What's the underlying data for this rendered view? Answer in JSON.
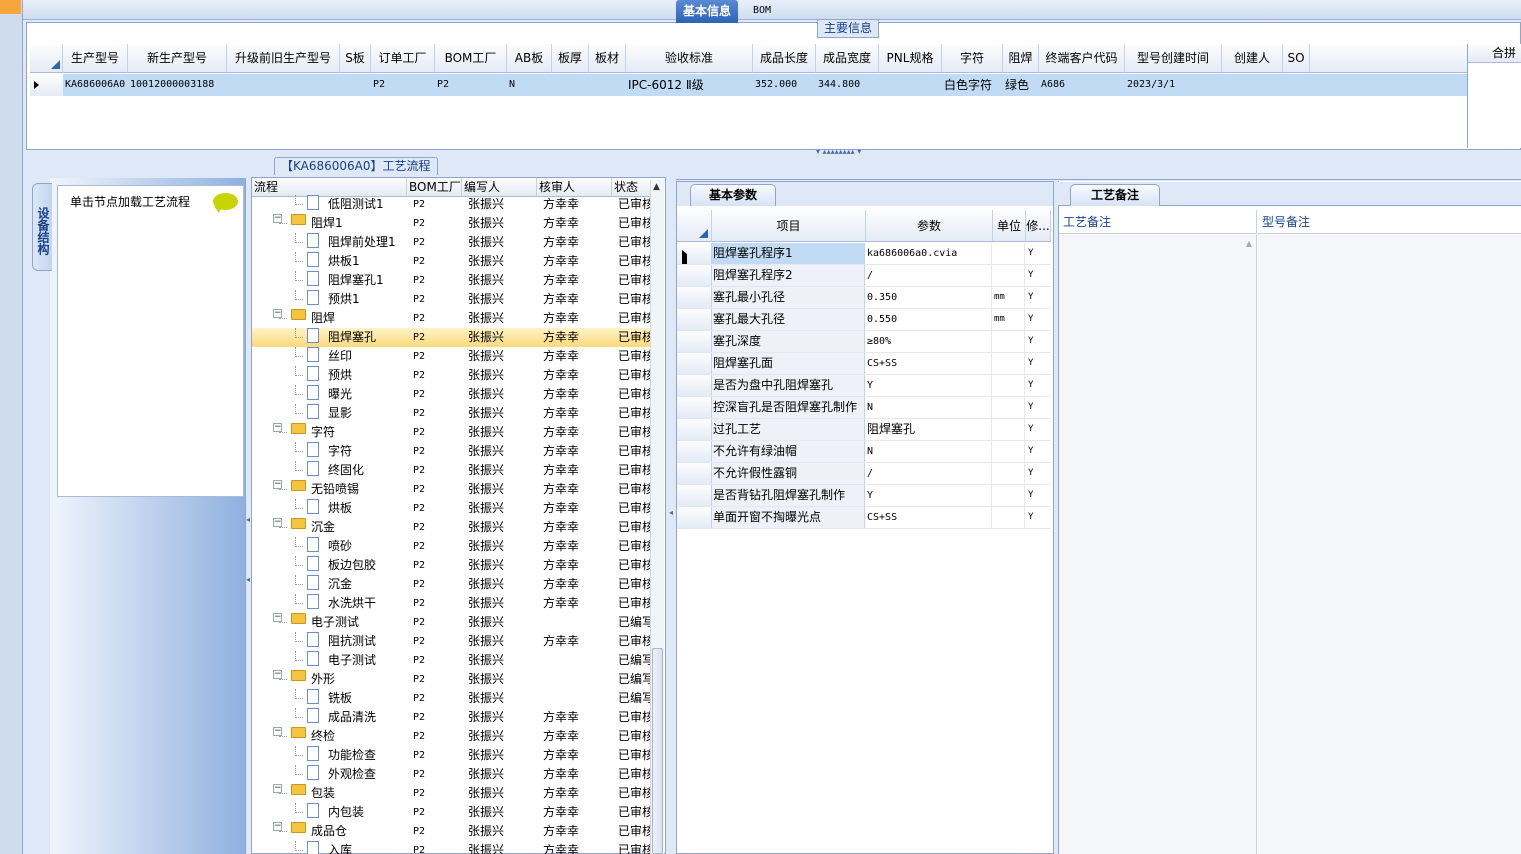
{
  "colors": {
    "accent": "#15428b",
    "selected_row": "#c2dbf5",
    "tree_selected": "#f9d97a",
    "folder": "#f5c443"
  },
  "main_info": {
    "title": "主要信息",
    "columns": [
      "生产型号",
      "新生产型号",
      "升级前旧生产型号",
      "S板",
      "订单工厂",
      "BOM工厂",
      "AB板",
      "板厚",
      "板材",
      "验收标准",
      "成品长度",
      "成品宽度",
      "PNL规格",
      "字符",
      "阻焊",
      "终端客户代码",
      "型号创建时间",
      "创建人",
      "SO"
    ],
    "row": [
      "KA686006A0",
      "10012000003188",
      "",
      "",
      "P2",
      "P2",
      "N",
      "",
      "",
      "IPC-6012 Ⅱ级",
      "352.000",
      "344.800",
      "",
      "白色字符",
      "绿色",
      "A686",
      "2023/3/1",
      "",
      ""
    ],
    "merge_label": "合拼"
  },
  "left_panel": {
    "vertical_tab": "设备结构",
    "hint": "单击节点加载工艺流程"
  },
  "process_tree": {
    "title": "【KA686006A0】工艺流程",
    "columns": [
      "流程",
      "BOM工厂",
      "编写人",
      "核审人",
      "状态"
    ],
    "rows": [
      {
        "name": "低阻测试1",
        "level": 2,
        "factory": "P2",
        "author": "张振兴",
        "reviewer": "方幸幸",
        "status": "已审核"
      },
      {
        "name": "阻焊1",
        "level": 1,
        "factory": "P2",
        "author": "张振兴",
        "reviewer": "方幸幸",
        "status": "已审核"
      },
      {
        "name": "阻焊前处理1",
        "level": 2,
        "factory": "P2",
        "author": "张振兴",
        "reviewer": "方幸幸",
        "status": "已审核"
      },
      {
        "name": "烘板1",
        "level": 2,
        "factory": "P2",
        "author": "张振兴",
        "reviewer": "方幸幸",
        "status": "已审核"
      },
      {
        "name": "阻焊塞孔1",
        "level": 2,
        "factory": "P2",
        "author": "张振兴",
        "reviewer": "方幸幸",
        "status": "已审核"
      },
      {
        "name": "预烘1",
        "level": 2,
        "factory": "P2",
        "author": "张振兴",
        "reviewer": "方幸幸",
        "status": "已审核"
      },
      {
        "name": "阻焊",
        "level": 1,
        "factory": "P2",
        "author": "张振兴",
        "reviewer": "方幸幸",
        "status": "已审核"
      },
      {
        "name": "阻焊塞孔",
        "level": 2,
        "factory": "P2",
        "author": "张振兴",
        "reviewer": "方幸幸",
        "status": "已审核",
        "selected": true
      },
      {
        "name": "丝印",
        "level": 2,
        "factory": "P2",
        "author": "张振兴",
        "reviewer": "方幸幸",
        "status": "已审核"
      },
      {
        "name": "预烘",
        "level": 2,
        "factory": "P2",
        "author": "张振兴",
        "reviewer": "方幸幸",
        "status": "已审核"
      },
      {
        "name": "曝光",
        "level": 2,
        "factory": "P2",
        "author": "张振兴",
        "reviewer": "方幸幸",
        "status": "已审核"
      },
      {
        "name": "显影",
        "level": 2,
        "factory": "P2",
        "author": "张振兴",
        "reviewer": "方幸幸",
        "status": "已审核"
      },
      {
        "name": "字符",
        "level": 1,
        "factory": "P2",
        "author": "张振兴",
        "reviewer": "方幸幸",
        "status": "已审核"
      },
      {
        "name": "字符",
        "level": 2,
        "factory": "P2",
        "author": "张振兴",
        "reviewer": "方幸幸",
        "status": "已审核"
      },
      {
        "name": "终固化",
        "level": 2,
        "factory": "P2",
        "author": "张振兴",
        "reviewer": "方幸幸",
        "status": "已审核"
      },
      {
        "name": "无铅喷锡",
        "level": 1,
        "factory": "P2",
        "author": "张振兴",
        "reviewer": "方幸幸",
        "status": "已审核"
      },
      {
        "name": "烘板",
        "level": 2,
        "factory": "P2",
        "author": "张振兴",
        "reviewer": "方幸幸",
        "status": "已审核"
      },
      {
        "name": "沉金",
        "level": 1,
        "factory": "P2",
        "author": "张振兴",
        "reviewer": "方幸幸",
        "status": "已审核"
      },
      {
        "name": "喷砂",
        "level": 2,
        "factory": "P2",
        "author": "张振兴",
        "reviewer": "方幸幸",
        "status": "已审核"
      },
      {
        "name": "板边包胶",
        "level": 2,
        "factory": "P2",
        "author": "张振兴",
        "reviewer": "方幸幸",
        "status": "已审核"
      },
      {
        "name": "沉金",
        "level": 2,
        "factory": "P2",
        "author": "张振兴",
        "reviewer": "方幸幸",
        "status": "已审核"
      },
      {
        "name": "水洗烘干",
        "level": 2,
        "factory": "P2",
        "author": "张振兴",
        "reviewer": "方幸幸",
        "status": "已审核"
      },
      {
        "name": "电子测试",
        "level": 1,
        "factory": "P2",
        "author": "张振兴",
        "reviewer": "",
        "status": "已编写"
      },
      {
        "name": "阻抗测试",
        "level": 2,
        "factory": "P2",
        "author": "张振兴",
        "reviewer": "方幸幸",
        "status": "已审核"
      },
      {
        "name": "电子测试",
        "level": 2,
        "factory": "P2",
        "author": "张振兴",
        "reviewer": "",
        "status": "已编写"
      },
      {
        "name": "外形",
        "level": 1,
        "factory": "P2",
        "author": "张振兴",
        "reviewer": "",
        "status": "已编写"
      },
      {
        "name": "铣板",
        "level": 2,
        "factory": "P2",
        "author": "张振兴",
        "reviewer": "",
        "status": "已编写"
      },
      {
        "name": "成品清洗",
        "level": 2,
        "factory": "P2",
        "author": "张振兴",
        "reviewer": "方幸幸",
        "status": "已审核"
      },
      {
        "name": "终检",
        "level": 1,
        "factory": "P2",
        "author": "张振兴",
        "reviewer": "方幸幸",
        "status": "已审核"
      },
      {
        "name": "功能检查",
        "level": 2,
        "factory": "P2",
        "author": "张振兴",
        "reviewer": "方幸幸",
        "status": "已审核"
      },
      {
        "name": "外观检查",
        "level": 2,
        "factory": "P2",
        "author": "张振兴",
        "reviewer": "方幸幸",
        "status": "已审核"
      },
      {
        "name": "包装",
        "level": 1,
        "factory": "P2",
        "author": "张振兴",
        "reviewer": "方幸幸",
        "status": "已审核"
      },
      {
        "name": "内包装",
        "level": 2,
        "factory": "P2",
        "author": "张振兴",
        "reviewer": "方幸幸",
        "status": "已审核"
      },
      {
        "name": "成品仓",
        "level": 1,
        "factory": "P2",
        "author": "张振兴",
        "reviewer": "方幸幸",
        "status": "已审核"
      },
      {
        "name": "入库",
        "level": 2,
        "factory": "P2",
        "author": "张振兴",
        "reviewer": "方幸幸",
        "status": "已审核"
      }
    ]
  },
  "right_tabs": [
    "基本信息",
    "BOM"
  ],
  "basic_params": {
    "tab": "基本参数",
    "columns": [
      "项目",
      "参数",
      "单位",
      "修..."
    ],
    "rows": [
      {
        "item": "阻焊塞孔程序1",
        "value": "ka686006a0.cvia",
        "unit": "",
        "flag": "Y",
        "selected": true
      },
      {
        "item": "阻焊塞孔程序2",
        "value": "/",
        "unit": "",
        "flag": "Y"
      },
      {
        "item": "塞孔最小孔径",
        "value": "0.350",
        "unit": "mm",
        "flag": "Y"
      },
      {
        "item": "塞孔最大孔径",
        "value": "0.550",
        "unit": "mm",
        "flag": "Y"
      },
      {
        "item": "塞孔深度",
        "value": "≥80%",
        "unit": "",
        "flag": "Y"
      },
      {
        "item": "阻焊塞孔面",
        "value": "CS+SS",
        "unit": "",
        "flag": "Y"
      },
      {
        "item": "是否为盘中孔阻焊塞孔",
        "value": "Y",
        "unit": "",
        "flag": "Y"
      },
      {
        "item": "控深盲孔是否阻焊塞孔制作",
        "value": "N",
        "unit": "",
        "flag": "Y"
      },
      {
        "item": "过孔工艺",
        "value": "阻焊塞孔",
        "unit": "",
        "flag": "Y"
      },
      {
        "item": "不允许有绿油帽",
        "value": "N",
        "unit": "",
        "flag": "Y"
      },
      {
        "item": "不允许假性露铜",
        "value": "/",
        "unit": "",
        "flag": "Y"
      },
      {
        "item": "是否背钻孔阻焊塞孔制作",
        "value": "Y",
        "unit": "",
        "flag": "Y"
      },
      {
        "item": "单面开窗不掏曝光点",
        "value": "CS+SS",
        "unit": "",
        "flag": "Y"
      }
    ]
  },
  "process_notes": {
    "tab": "工艺备注",
    "columns": [
      "工艺备注",
      "型号备注"
    ]
  }
}
